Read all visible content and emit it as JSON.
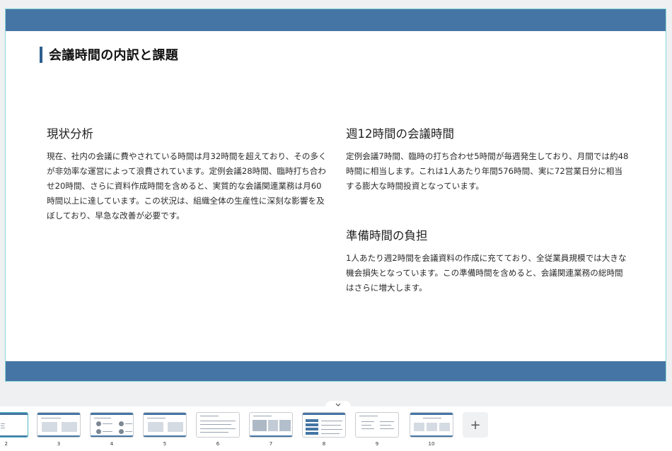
{
  "slide": {
    "title": "会議時間の内訳と課題",
    "sections": [
      {
        "heading": "現状分析",
        "body": "現在、社内の会議に費やされている時間は月32時間を超えており、その多くが非効率な運営によって浪費されています。定例会議28時間、臨時打ち合わせ20時間、さらに資料作成時間を含めると、実質的な会議関連業務は月60時間以上に達しています。この状況は、組織全体の生産性に深刻な影響を及ぼしており、早急な改善が必要です。"
      },
      {
        "heading": "週12時間の会議時間",
        "body": "定例会議7時間、臨時の打ち合わせ5時間が毎週発生しており、月間では約48時間に相当します。これは1人あたり年間576時間、実に72営業日分に相当する膨大な時間投資となっています。"
      },
      {
        "heading": "準備時間の負担",
        "body": "1人あたり週2時間を会議資料の作成に充てており、全従業員規模では大きな機会損失となっています。この準備時間を含めると、会議関連業務の総時間はさらに増大します。"
      }
    ],
    "colors": {
      "band": "#4575a4",
      "title_accent": "#2f5e8e",
      "selection": "#8ad7d8"
    }
  },
  "collapse_icon": "chevron-down-icon",
  "filmstrip": {
    "thumbnails": [
      {
        "number": "2",
        "active": true
      },
      {
        "number": "3",
        "active": false
      },
      {
        "number": "4",
        "active": false
      },
      {
        "number": "5",
        "active": false
      },
      {
        "number": "6",
        "active": false
      },
      {
        "number": "7",
        "active": false
      },
      {
        "number": "8",
        "active": false
      },
      {
        "number": "9",
        "active": false
      },
      {
        "number": "10",
        "active": false
      }
    ],
    "add_label": "+"
  }
}
